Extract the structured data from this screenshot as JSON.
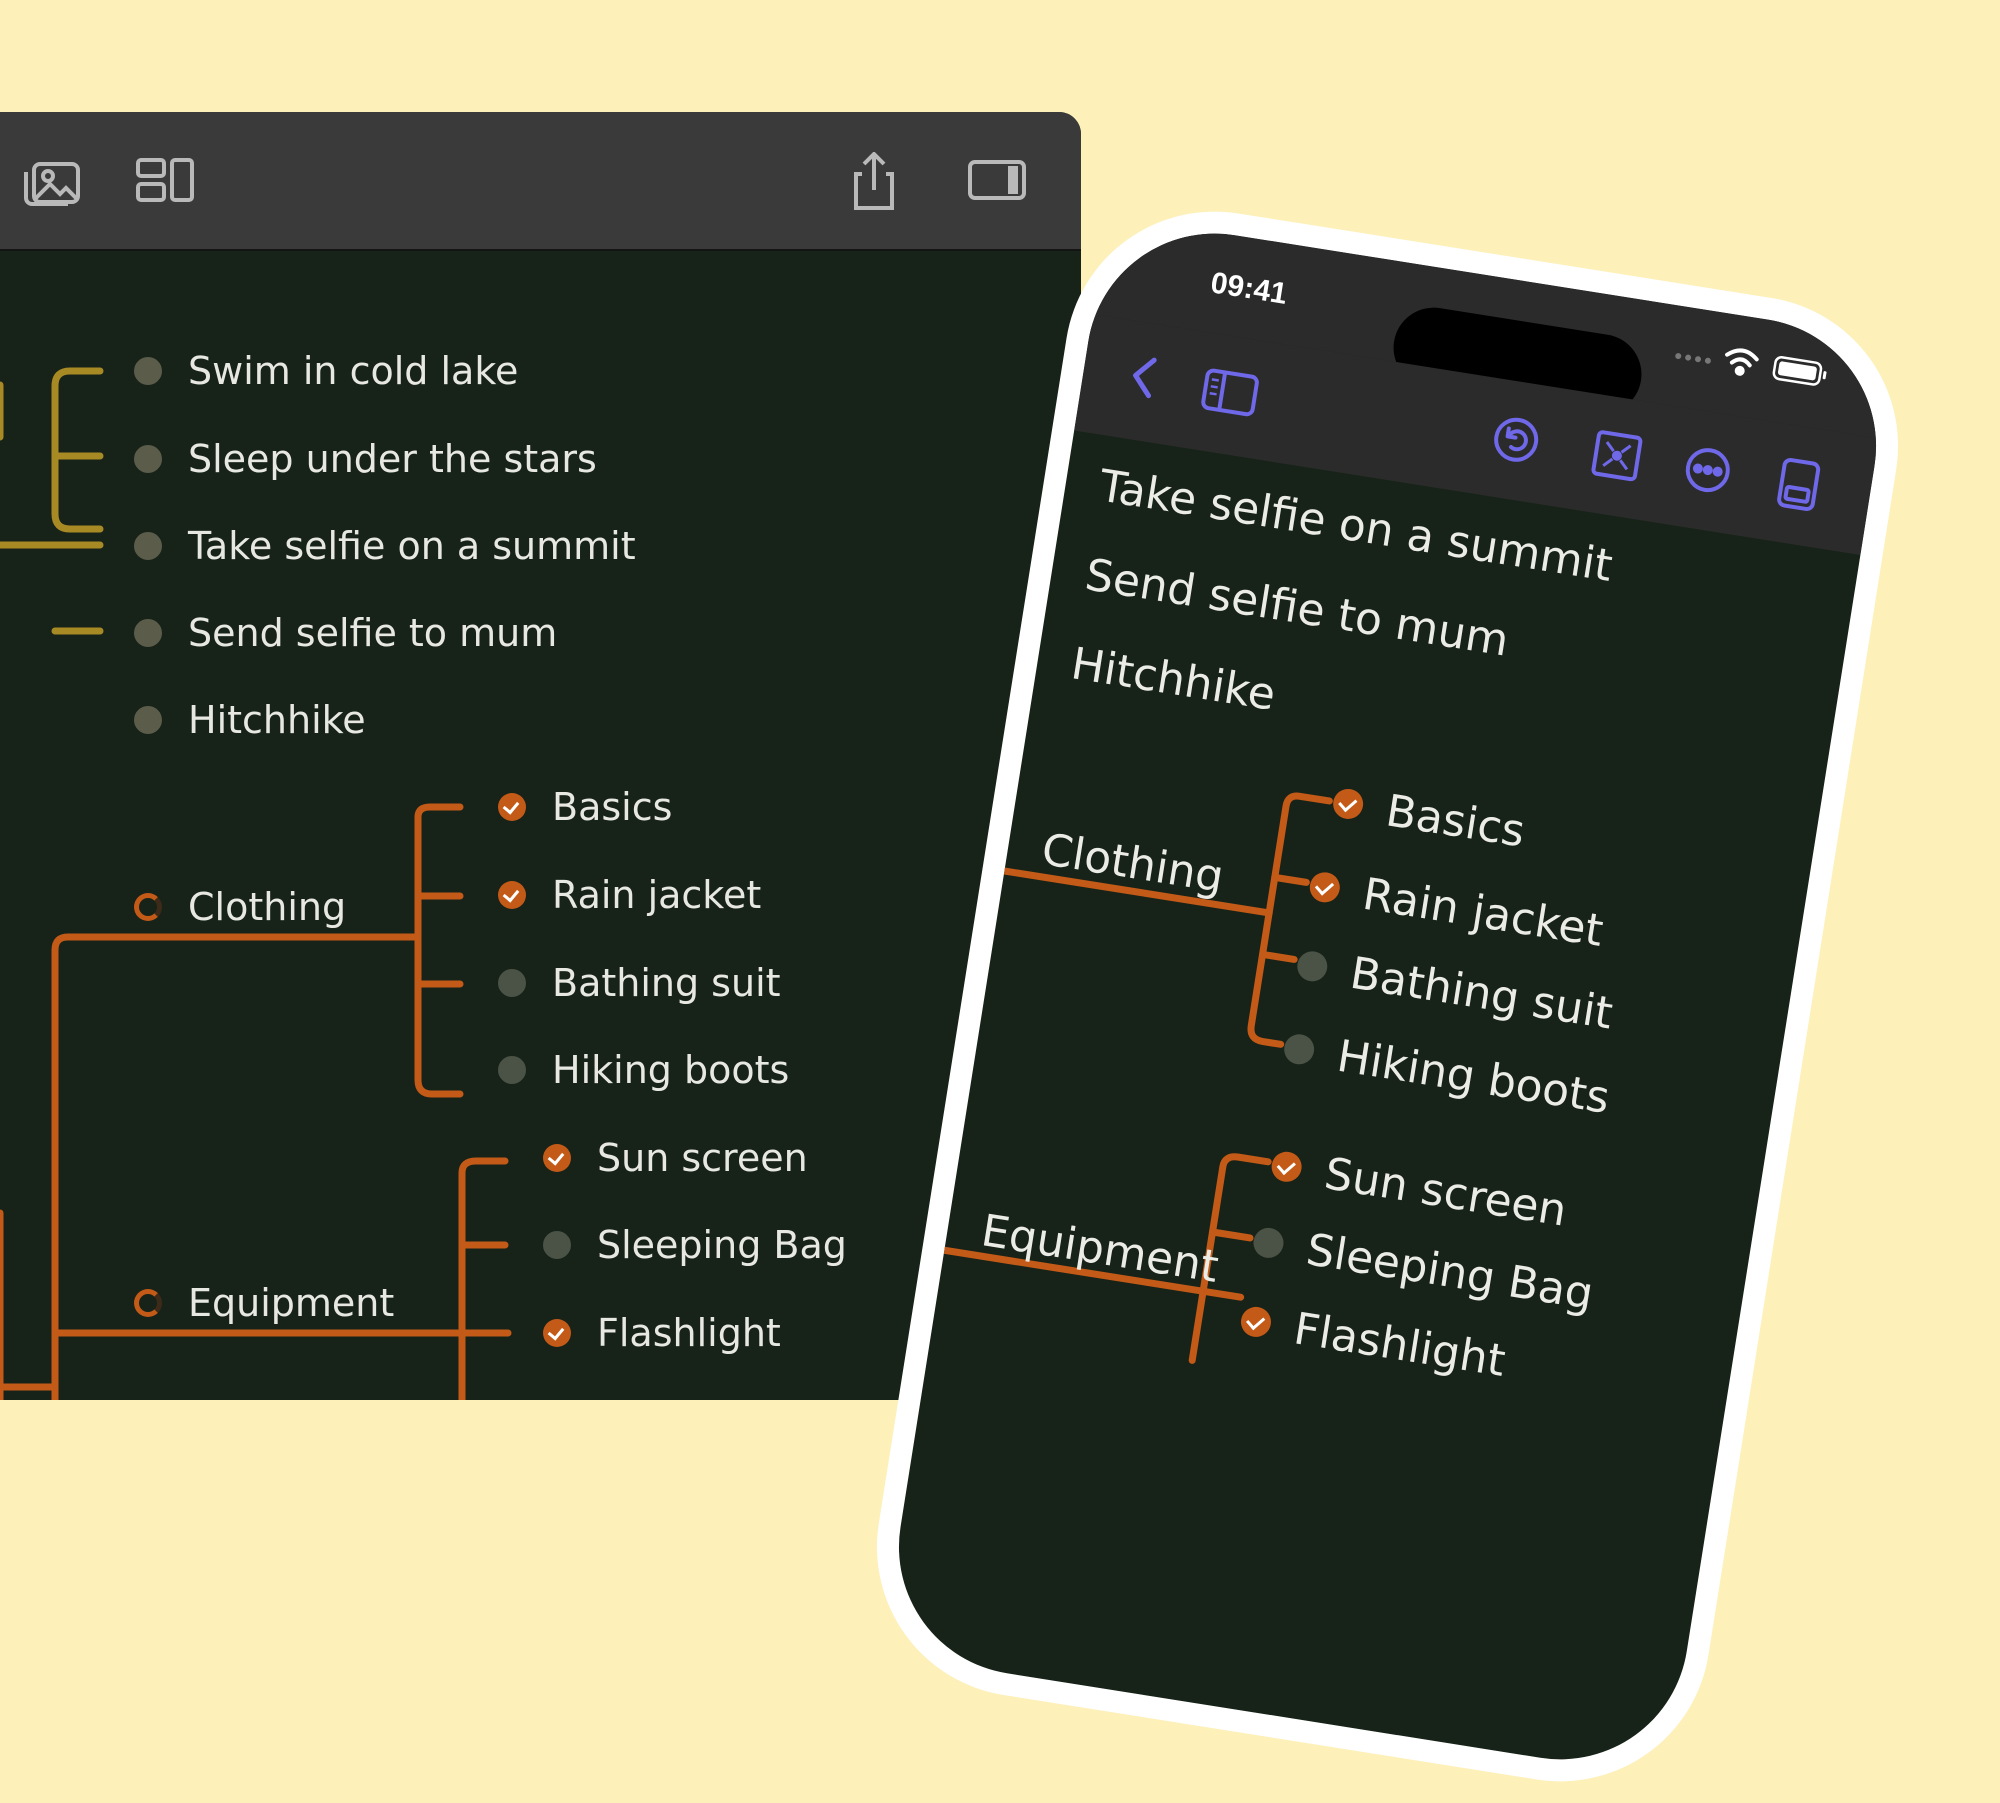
{
  "colors": {
    "background": "#fdf0b9",
    "canvas": "#172318",
    "accent_gold": "#a88a25",
    "accent_orange": "#c35a17",
    "phone_tint": "#6f68e8"
  },
  "desktop": {
    "toolbar": {
      "icons": [
        "photo-library-icon",
        "layout-icon",
        "share-icon",
        "sidebar-toggle-icon"
      ]
    },
    "top_branch": [
      {
        "label": "Swim in cold lake",
        "done": false
      },
      {
        "label": "Sleep under the stars",
        "done": false
      },
      {
        "label": "Take selfie on a summit",
        "done": false
      },
      {
        "label": "Send selfie to mum",
        "done": false
      },
      {
        "label": "Hitchhike",
        "done": false
      }
    ],
    "clothing": {
      "label": "Clothing",
      "items": [
        {
          "label": "Basics",
          "done": true
        },
        {
          "label": "Rain jacket",
          "done": true
        },
        {
          "label": "Bathing suit",
          "done": false
        },
        {
          "label": "Hiking boots",
          "done": false
        }
      ]
    },
    "equipment": {
      "label": "Equipment",
      "items": [
        {
          "label": "Sun screen",
          "done": true
        },
        {
          "label": "Sleeping Bag",
          "done": false
        },
        {
          "label": "Flashlight",
          "done": true
        }
      ]
    }
  },
  "phone": {
    "status_time": "09:41",
    "toolbar": {
      "icons": [
        "back-chevron-icon",
        "sidebar-icon",
        "undo-icon",
        "focus-icon",
        "more-icon",
        "panel-icon"
      ]
    },
    "top_items": [
      "Take selfie on a summit",
      "Send selfie to mum",
      "Hitchhike"
    ],
    "clothing": {
      "label": "Clothing",
      "items": [
        {
          "label": "Basics",
          "done": true
        },
        {
          "label": "Rain jacket",
          "done": true
        },
        {
          "label": "Bathing suit",
          "done": false
        },
        {
          "label": "Hiking boots",
          "done": false
        }
      ]
    },
    "equipment": {
      "label": "Equipment",
      "items": [
        {
          "label": "Sun screen",
          "done": true
        },
        {
          "label": "Sleeping Bag",
          "done": false
        },
        {
          "label": "Flashlight",
          "done": true
        }
      ]
    }
  }
}
